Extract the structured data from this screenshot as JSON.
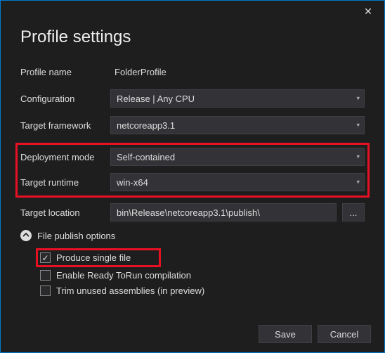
{
  "title": "Profile settings",
  "fields": {
    "profileName": {
      "label": "Profile name",
      "value": "FolderProfile"
    },
    "configuration": {
      "label": "Configuration",
      "value": "Release | Any CPU"
    },
    "targetFramework": {
      "label": "Target framework",
      "value": "netcoreapp3.1"
    },
    "deploymentMode": {
      "label": "Deployment mode",
      "value": "Self-contained"
    },
    "targetRuntime": {
      "label": "Target runtime",
      "value": "win-x64"
    },
    "targetLocation": {
      "label": "Target location",
      "value": "bin\\Release\\netcoreapp3.1\\publish\\"
    }
  },
  "browse": "...",
  "expander": {
    "label": "File publish options"
  },
  "options": {
    "singleFile": "Produce single file",
    "readyToRun": "Enable Ready ToRun compilation",
    "trimUnused": "Trim unused assemblies (in preview)"
  },
  "buttons": {
    "save": "Save",
    "cancel": "Cancel"
  }
}
